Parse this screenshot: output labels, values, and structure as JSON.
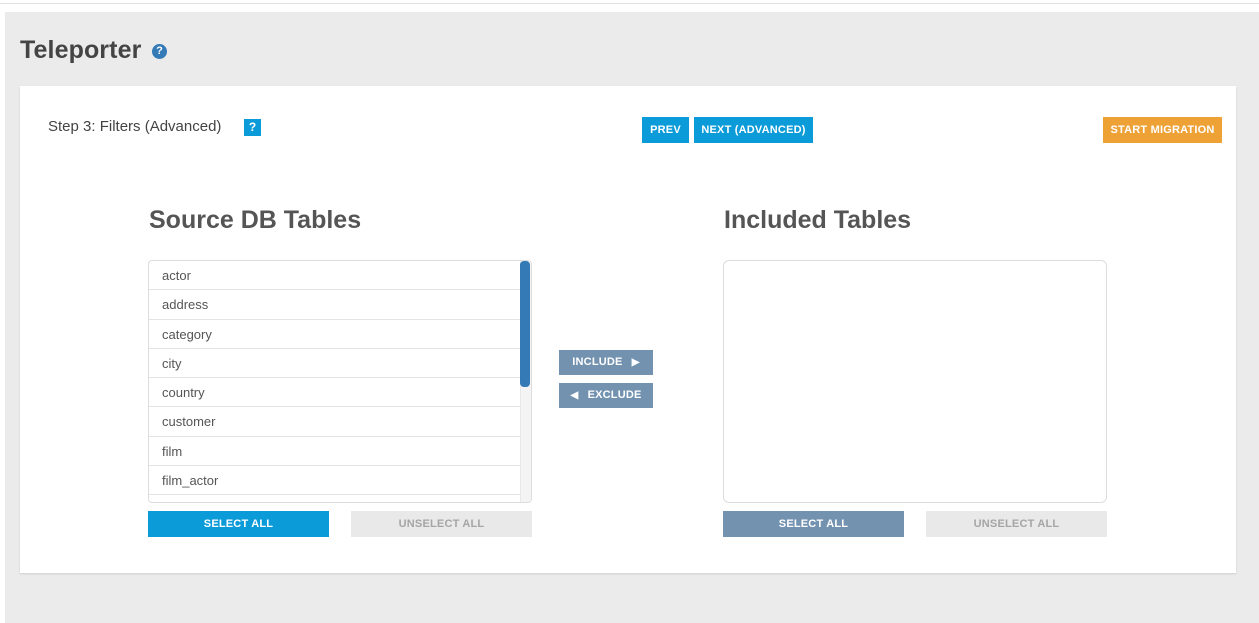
{
  "header": {
    "title": "Teleporter",
    "help_icon": "question-circle-icon"
  },
  "step": {
    "label": "Step 3: Filters (Advanced)",
    "help_text": "?"
  },
  "nav": {
    "prev_label": "PREV",
    "next_label": "NEXT (ADVANCED)",
    "start_label": "START MIGRATION"
  },
  "source": {
    "title": "Source DB Tables",
    "items": [
      "actor",
      "address",
      "category",
      "city",
      "country",
      "customer",
      "film",
      "film_actor"
    ],
    "select_all_label": "SELECT ALL",
    "unselect_all_label": "UNSELECT ALL"
  },
  "transfer": {
    "include_label": "INCLUDE",
    "exclude_label": "EXCLUDE"
  },
  "included": {
    "title": "Included Tables",
    "items": [],
    "select_all_label": "SELECT ALL",
    "unselect_all_label": "UNSELECT ALL"
  },
  "colors": {
    "primary": "#0a9bd8",
    "start_migration": "#eea236",
    "muted_button": "#7292b0",
    "disabled_button": "#e9e9e9",
    "scroll_thumb": "#337ab7"
  }
}
